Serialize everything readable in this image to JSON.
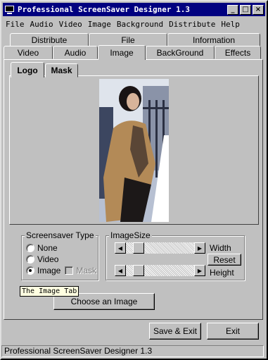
{
  "window": {
    "title": "Professional ScreenSaver Designer 1.3",
    "controls": {
      "minimize": "_",
      "maximize": "□",
      "close": "×"
    }
  },
  "menu": [
    "File",
    "Audio",
    "Video",
    "Image",
    "Background",
    "Distribute",
    "Help"
  ],
  "tabs": {
    "back_row": [
      "Distribute",
      "File",
      "Information"
    ],
    "front_row": [
      "Video",
      "Audio",
      "Image",
      "BackGround",
      "Effects"
    ],
    "active": "Image"
  },
  "subtabs": {
    "items": [
      "Logo",
      "Mask"
    ],
    "active": "Logo"
  },
  "screensaver_type": {
    "title": "Screensaver Type",
    "options": [
      "None",
      "Video",
      "Image"
    ],
    "selected": "Image",
    "mask_label": "Mask"
  },
  "image_size": {
    "title": "ImageSize",
    "width_label": "Width",
    "height_label": "Height",
    "reset_label": "Reset"
  },
  "tooltip": "The Image Tab",
  "buttons": {
    "choose_image": "Choose an Image",
    "save_exit": "Save & Exit",
    "exit": "Exit"
  },
  "status": "Professional ScreenSaver Designer 1.3",
  "icons": {
    "app": "monitor-icon",
    "arrow_left": "◀",
    "arrow_right": "▶"
  }
}
